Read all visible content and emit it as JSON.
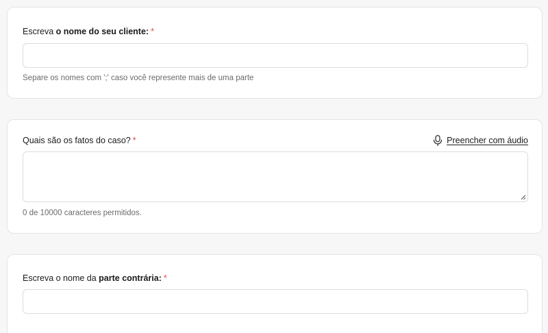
{
  "client_section": {
    "label_prefix": "Escreva ",
    "label_bold": "o nome do seu cliente:",
    "required_mark": "*",
    "input_value": "",
    "input_placeholder": "",
    "helper": "Separe os nomes com ';' caso você represente mais de uma parte"
  },
  "facts_section": {
    "label": "Quais são os fatos do caso?",
    "required_mark": "*",
    "audio_link_label": "Preencher com áudio",
    "audio_icon": "microphone-icon",
    "textarea_value": "",
    "counter": "0 de 10000 caracteres permitidos."
  },
  "opponent_section": {
    "label_prefix": "Escreva o nome da ",
    "label_bold": "parte contrária:",
    "required_mark": "*",
    "input_value": "",
    "input_placeholder": ""
  },
  "colors": {
    "required": "#e5484d",
    "border": "#dcdcdc",
    "helper_text": "#6b6b6b",
    "page_bg": "#f7f7f7"
  }
}
